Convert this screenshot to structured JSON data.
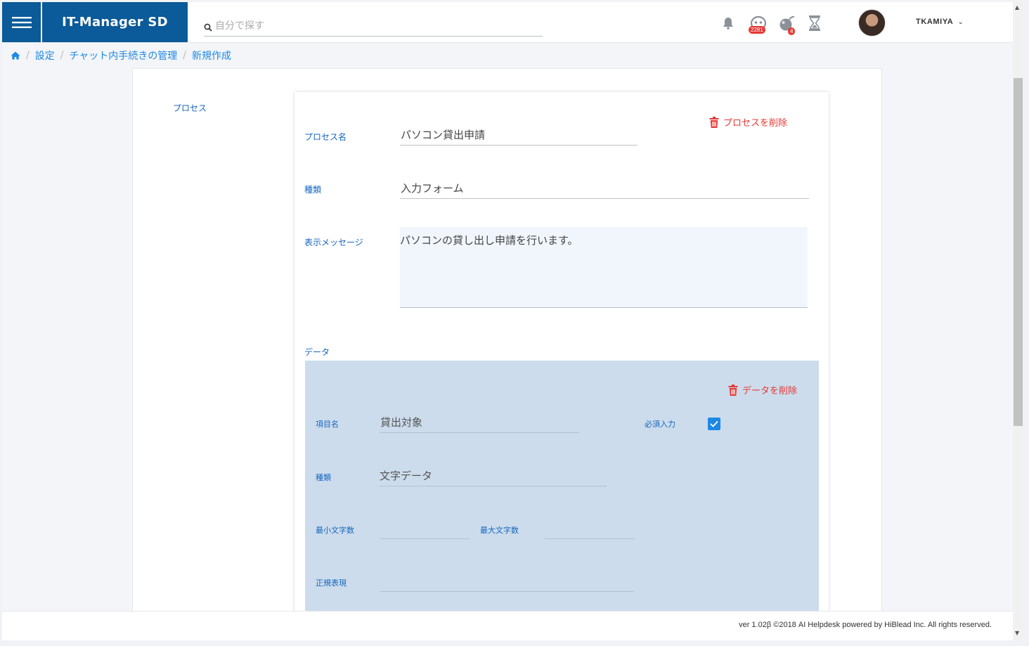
{
  "app": {
    "brand": "IT-Manager SD",
    "menu_icon": "hamburger-icon",
    "accent_color": "#0b5a99"
  },
  "search": {
    "placeholder": "自分で探す",
    "icon": "search-icon"
  },
  "notifications": {
    "bell_icon": "bell-icon",
    "face_badge": "2281",
    "bomb_badge": "4",
    "hourglass_icon": "hourglass-icon"
  },
  "user": {
    "name": "TKAMIYA",
    "chevron": "⌄"
  },
  "breadcrumb": {
    "home_icon": "home-icon",
    "items": [
      "設定",
      "チャット内手続きの管理",
      "新規作成"
    ],
    "separator": "/"
  },
  "process_section": {
    "section_label": "プロセス",
    "delete_label": "プロセスを削除",
    "name_label": "プロセス名",
    "name_value": "パソコン貸出申請",
    "type_label": "種類",
    "type_value": "入力フォーム",
    "message_label": "表示メッセージ",
    "message_value": "パソコンの貸し出し申請を行います。"
  },
  "data_section": {
    "section_label": "データ",
    "delete_label": "データを削除",
    "item_name_label": "項目名",
    "item_name_value": "貸出対象",
    "required_label": "必須入力",
    "required_checked": true,
    "type_label": "種類",
    "type_value": "文字データ",
    "min_chars_label": "最小文字数",
    "min_chars_value": "",
    "max_chars_label": "最大文字数",
    "max_chars_value": "",
    "regex_label": "正規表現",
    "regex_value": ""
  },
  "footer": {
    "text": "ver 1.02β ©2018 AI Helpdesk powered by HiBlead Inc. All rights reserved."
  },
  "colors": {
    "delete": "#e53935",
    "label": "#1565c0",
    "data_panel": "#ccdcec"
  }
}
